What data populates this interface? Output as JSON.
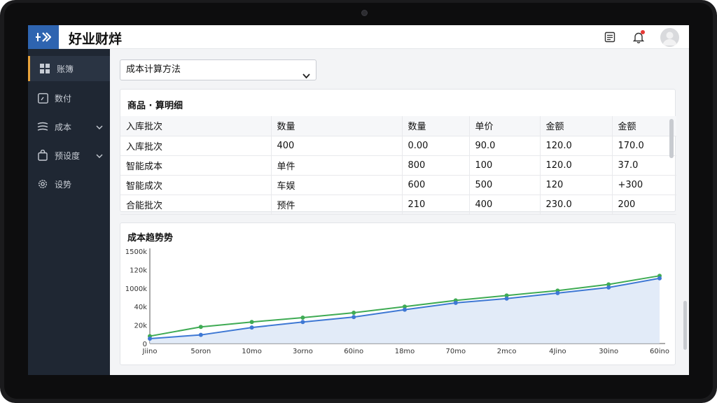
{
  "app": {
    "title": "好业财烊"
  },
  "colors": {
    "brand": "#2e64b0",
    "sidebar": "#1f2733",
    "accent": "#e8a33b",
    "line_green": "#3fab54",
    "line_blue": "#3e78d4"
  },
  "header": {
    "icons": [
      "document-list-icon",
      "bell-icon",
      "avatar"
    ]
  },
  "sidebar": {
    "items": [
      {
        "label": "账簿",
        "icon": "grid-icon",
        "active": true,
        "expandable": false
      },
      {
        "label": "数付",
        "icon": "chart-box-icon",
        "active": false,
        "expandable": false
      },
      {
        "label": "成本",
        "icon": "stack-icon",
        "active": false,
        "expandable": true
      },
      {
        "label": "预设度",
        "icon": "bag-icon",
        "active": false,
        "expandable": true
      },
      {
        "label": "设势",
        "icon": "gear-icon",
        "active": false,
        "expandable": false
      }
    ]
  },
  "method_select": {
    "value": "成本计算方法"
  },
  "detail_table": {
    "title": "商品 · 算明细",
    "columns": [
      "入库批次",
      "数量",
      "数量",
      "单价",
      "金额",
      "金额"
    ],
    "rows": [
      [
        "入库批次",
        "400",
        "0.00",
        "90.0",
        "120.0",
        "170.0"
      ],
      [
        "智能成本",
        "单件",
        "800",
        "100",
        "120.0",
        "37.0"
      ],
      [
        "智能成次",
        "车娱",
        "600",
        "500",
        "120",
        "+300"
      ],
      [
        "合能批次",
        "预件",
        "210",
        "400",
        "230.0",
        "200"
      ]
    ]
  },
  "trend": {
    "title": "成本趋势势"
  },
  "chart_data": {
    "type": "line",
    "title": "成本趋势势",
    "x": [
      "Jiino",
      "5oron",
      "10mo",
      "3orno",
      "60ino",
      "18mo",
      "70mo",
      "2mco",
      "4Jino",
      "30ino",
      "60ino"
    ],
    "y_ticks": [
      "0",
      "20k",
      "40k",
      "1000k",
      "120k",
      "1500k"
    ],
    "ylim": [
      0,
      150
    ],
    "grid": false,
    "series": [
      {
        "color": "#3fab54",
        "values": [
          12,
          27,
          35,
          42,
          50,
          60,
          70,
          78,
          86,
          96,
          110
        ]
      },
      {
        "color": "#3e78d4",
        "values": [
          8,
          14,
          26,
          35,
          43,
          55,
          66,
          73,
          82,
          91,
          106
        ],
        "fill": true
      }
    ]
  }
}
